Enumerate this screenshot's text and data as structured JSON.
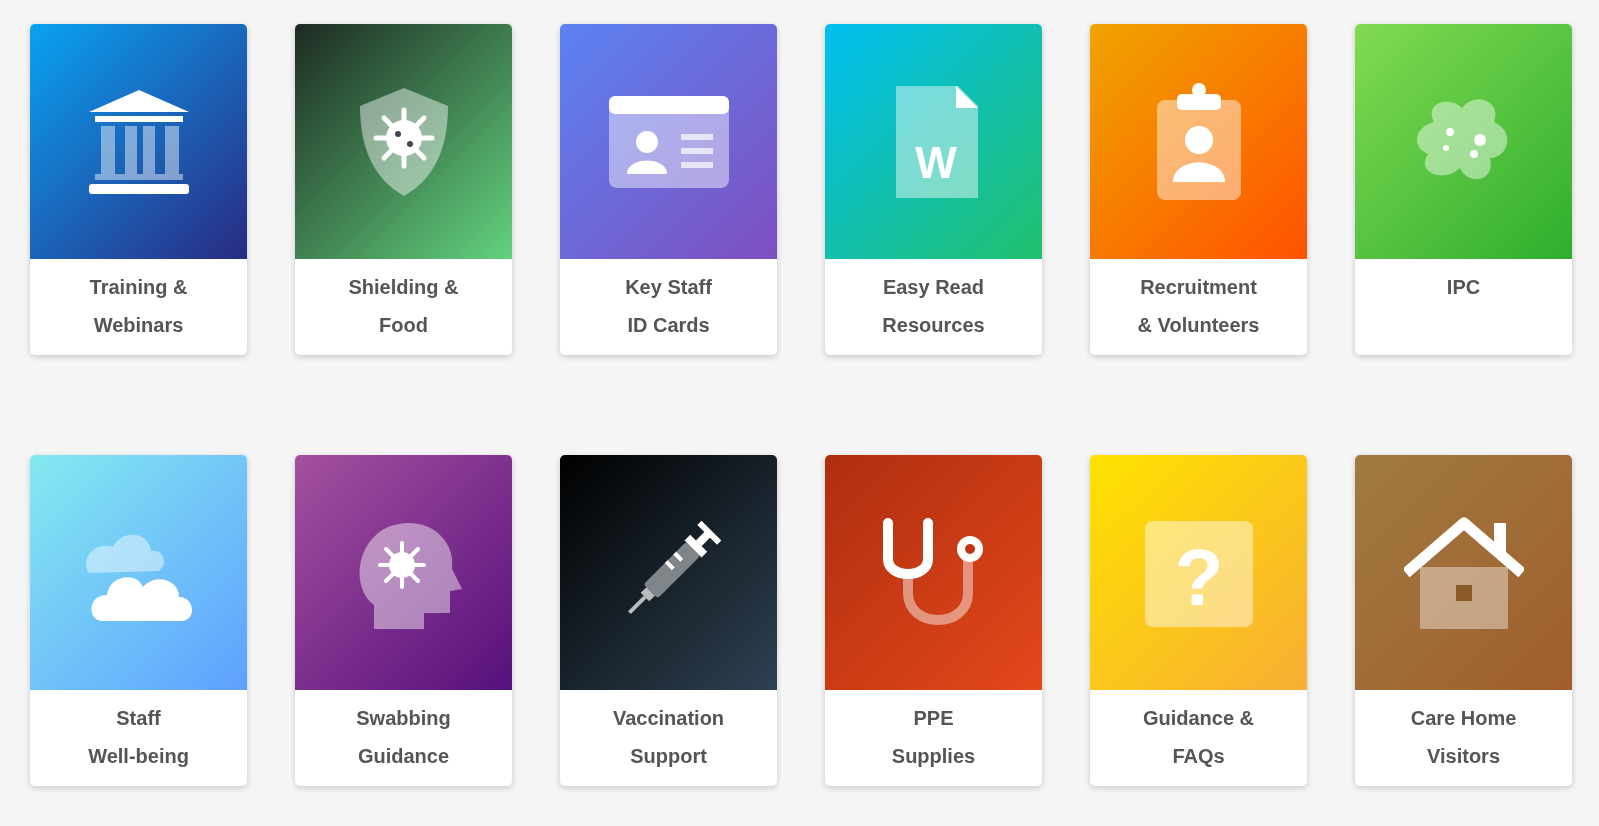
{
  "tiles": [
    {
      "lines": [
        "Training &",
        "Webinars"
      ]
    },
    {
      "lines": [
        "Shielding &",
        "Food"
      ]
    },
    {
      "lines": [
        "Key Staff",
        "ID Cards"
      ]
    },
    {
      "lines": [
        "Easy Read",
        "Resources"
      ],
      "icon_glyph": "W"
    },
    {
      "lines": [
        "Recruitment",
        "& Volunteers"
      ]
    },
    {
      "lines": [
        "IPC"
      ]
    },
    {
      "lines": [
        "Staff",
        "Well-being"
      ]
    },
    {
      "lines": [
        "Swabbing",
        "Guidance"
      ]
    },
    {
      "lines": [
        "Vaccination",
        "Support"
      ]
    },
    {
      "lines": [
        "PPE",
        "Supplies"
      ]
    },
    {
      "lines": [
        "Guidance &",
        "FAQs"
      ],
      "icon_glyph": "?"
    },
    {
      "lines": [
        "Care Home",
        "Visitors"
      ]
    }
  ]
}
